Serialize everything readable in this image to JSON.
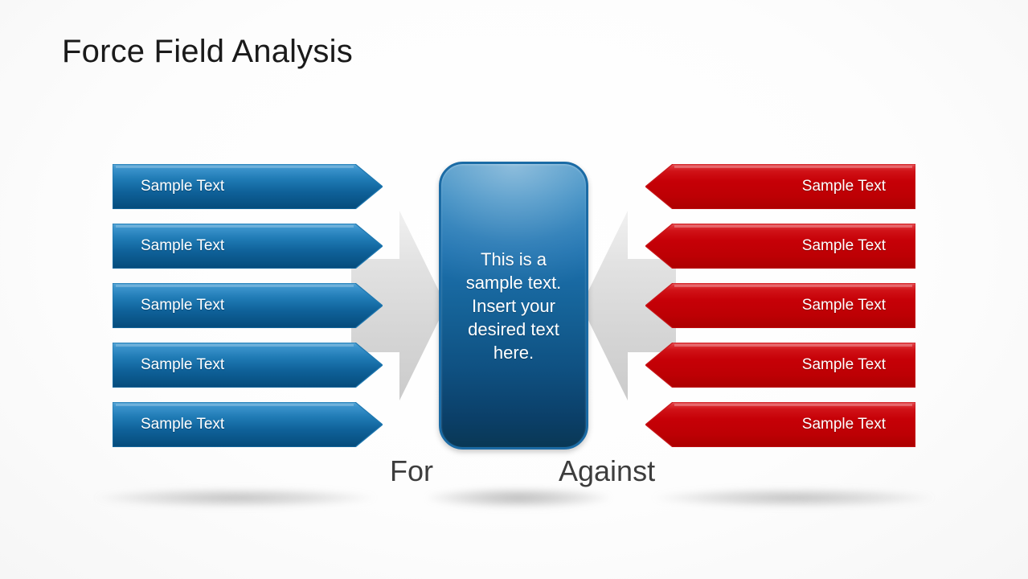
{
  "slide": {
    "title": "Force Field Analysis",
    "background_color": "#f2f2f2"
  },
  "colors": {
    "blue_light": "#3d8fc4",
    "blue_dark": "#064b7c",
    "blue_border": "#1b6ba5",
    "red_light": "#e03a3a",
    "red_dark": "#b40000",
    "red_mid": "#cc0000",
    "gray_arrow": "#d8d8d8",
    "text_dark": "#3d3d3d",
    "text_on_shape": "#ffffff"
  },
  "left_column": {
    "caption": "For",
    "direction": "right",
    "items": [
      {
        "label": "Sample Text"
      },
      {
        "label": "Sample Text"
      },
      {
        "label": "Sample Text"
      },
      {
        "label": "Sample Text"
      },
      {
        "label": "Sample Text"
      }
    ]
  },
  "right_column": {
    "caption": "Against",
    "direction": "left",
    "items": [
      {
        "label": "Sample Text"
      },
      {
        "label": "Sample Text"
      },
      {
        "label": "Sample Text"
      },
      {
        "label": "Sample Text"
      },
      {
        "label": "Sample Text"
      }
    ]
  },
  "center": {
    "text": "This is a sample text. Insert your desired text here."
  },
  "icons": {
    "left_force_arrow": "arrow-right-icon",
    "right_force_arrow": "arrow-left-icon"
  }
}
